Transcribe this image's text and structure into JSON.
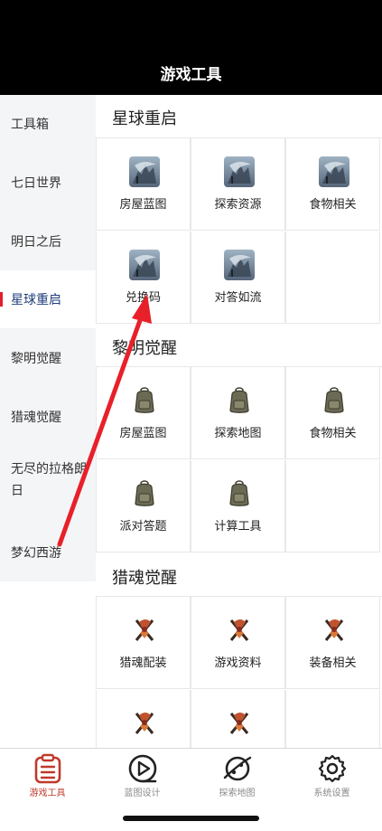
{
  "header": {
    "title": "游戏工具"
  },
  "sidebar": {
    "items": [
      {
        "label": "工具箱"
      },
      {
        "label": "七日世界"
      },
      {
        "label": "明日之后"
      },
      {
        "label": "星球重启",
        "active": true
      },
      {
        "label": "黎明觉醒"
      },
      {
        "label": "猎魂觉醒"
      },
      {
        "label": "无尽的拉格朗日"
      },
      {
        "label": "梦幻西游"
      }
    ]
  },
  "sections": [
    {
      "title": "星球重启",
      "icon": "dragon-art-icon",
      "items": [
        "房屋蓝图",
        "探索资源",
        "食物相关",
        "兑换码",
        "对答如流"
      ]
    },
    {
      "title": "黎明觉醒",
      "icon": "backpack-icon",
      "items": [
        "房屋蓝图",
        "探索地图",
        "食物相关",
        "派对答题",
        "计算工具"
      ]
    },
    {
      "title": "猎魂觉醒",
      "icon": "axe-emblem-icon",
      "items": [
        "猎魂配装",
        "游戏资料",
        "装备相关",
        "",
        ""
      ]
    }
  ],
  "tabbar": {
    "tabs": [
      {
        "label": "游戏工具",
        "icon": "clipboard-list-icon",
        "active": true
      },
      {
        "label": "蓝图设计",
        "icon": "play-circle-icon"
      },
      {
        "label": "探索地图",
        "icon": "planet-icon"
      },
      {
        "label": "系统设置",
        "icon": "gear-icon"
      }
    ]
  },
  "colors": {
    "active_tab": "#c0392b",
    "active_side_text": "#1d3e7a",
    "side_marker": "#e11d2e",
    "annotation_arrow": "#e8202a"
  }
}
